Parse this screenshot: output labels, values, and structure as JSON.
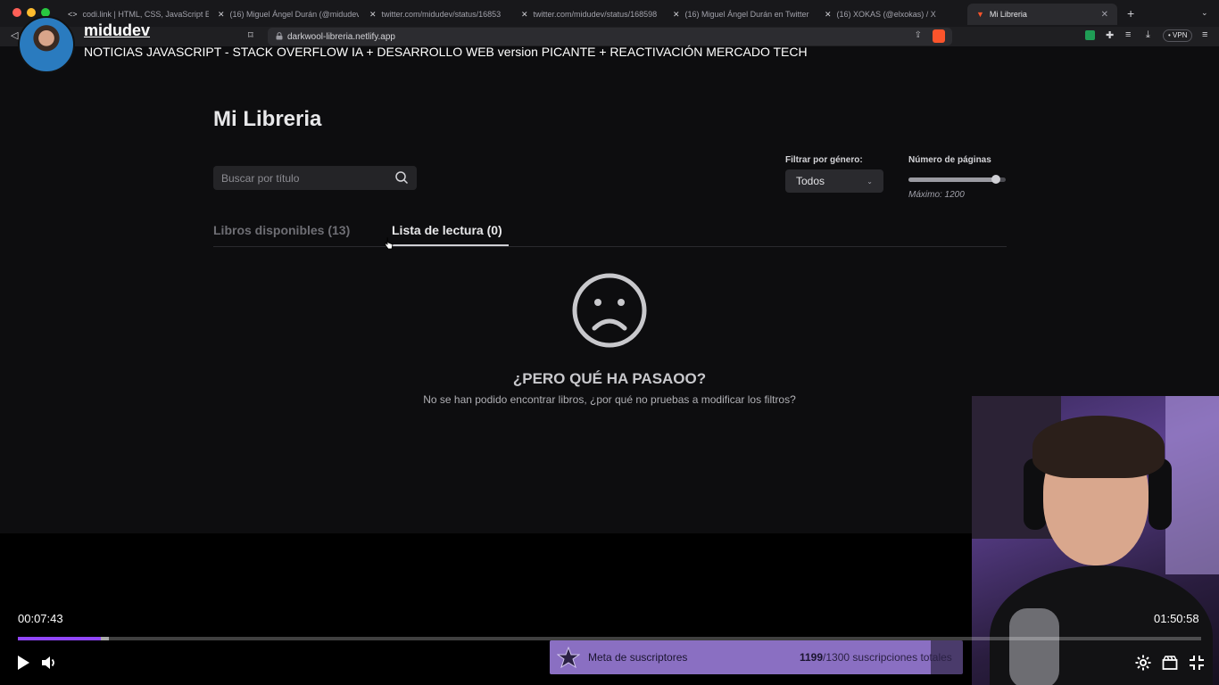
{
  "browser": {
    "tabs": [
      {
        "favicon": "vscode-icon",
        "label": "codi.link | HTML, CSS, JavaScript E"
      },
      {
        "favicon": "x-icon",
        "label": "(16) Miguel Ángel Durán (@midudev"
      },
      {
        "favicon": "x-icon",
        "label": "twitter.com/midudev/status/16853"
      },
      {
        "favicon": "x-icon",
        "label": "twitter.com/midudev/status/168598"
      },
      {
        "favicon": "x-icon",
        "label": "(16) Miguel Ángel Durán en Twitter"
      },
      {
        "favicon": "x-icon",
        "label": "(16) XOKAS (@elxokas) / X"
      },
      {
        "favicon": "brave-icon",
        "label": "Mi Libreria",
        "active": true
      }
    ],
    "url": "darkwool-libreria.netlify.app",
    "vpn_label": "• VPN"
  },
  "overlay": {
    "channel": "midudev",
    "video_title": "NOTICIAS JAVASCRIPT - STACK OVERFLOW IA + DESARROLLO WEB version PICANTE + REACTIVACIÓN MERCADO TECH"
  },
  "page": {
    "heading": "Mi Libreria",
    "search_placeholder": "Buscar por título",
    "genre_label": "Filtrar por género:",
    "genre_value": "Todos",
    "pages_label": "Número de páginas",
    "pages_max": "Máximo: 1200",
    "pages_slider_fraction": 0.9,
    "tabs": [
      {
        "label": "Libros disponibles (13)",
        "active": false
      },
      {
        "label": "Lista de lectura (0)",
        "active": true
      }
    ],
    "empty_title": "¿PERO QUÉ HA PASAOO?",
    "empty_subtitle": "No se han podido encontrar libros, ¿por qué no pruebas a modificar los filtros?"
  },
  "player": {
    "current_time": "00:07:43",
    "total_time": "01:50:58",
    "played_fraction": 0.07,
    "buffered_fraction": 0.077,
    "goal_label": "Meta de suscriptores",
    "goal_current": "1199",
    "goal_rest": "/1300 suscripciones totales",
    "goal_fraction": 0.922,
    "accent": "#9146ff"
  }
}
